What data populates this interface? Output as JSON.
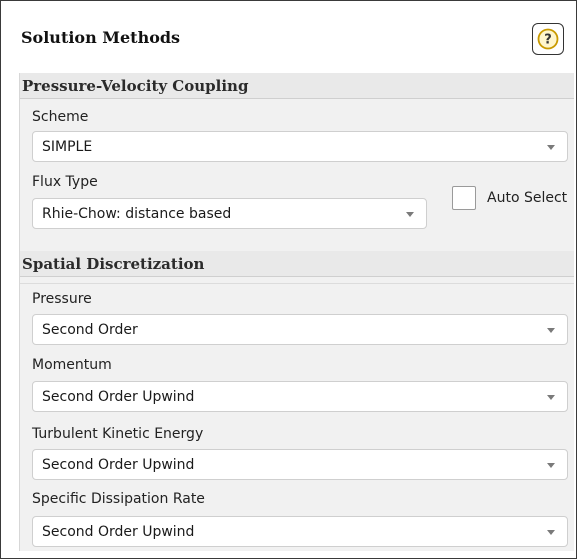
{
  "panel": {
    "title": "Solution Methods",
    "help_icon": "question-circle-icon"
  },
  "pressure_velocity_coupling": {
    "header": "Pressure-Velocity Coupling",
    "scheme": {
      "label": "Scheme",
      "value": "SIMPLE"
    },
    "flux_type": {
      "label": "Flux Type",
      "value": "Rhie-Chow: distance based"
    },
    "auto_select": {
      "label": "Auto Select",
      "checked": false
    }
  },
  "spatial_discretization": {
    "header": "Spatial Discretization",
    "fields": [
      {
        "label": "Pressure",
        "value": "Second Order"
      },
      {
        "label": "Momentum",
        "value": "Second Order Upwind"
      },
      {
        "label": "Turbulent Kinetic Energy",
        "value": "Second Order Upwind"
      },
      {
        "label": "Specific Dissipation Rate",
        "value": "Second Order Upwind"
      }
    ]
  }
}
